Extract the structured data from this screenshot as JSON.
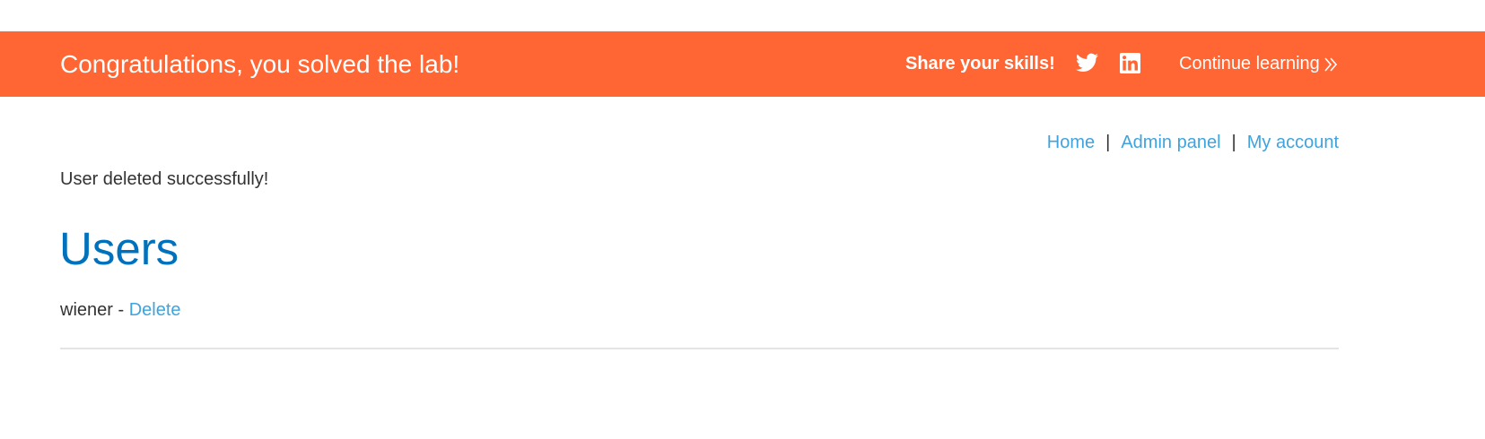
{
  "banner": {
    "title": "Congratulations, you solved the lab!",
    "share_label": "Share your skills!",
    "twitter_icon": "twitter-icon",
    "linkedin_icon": "linkedin-icon",
    "continue_label": "Continue learning",
    "background_color": "#ff6633"
  },
  "nav": {
    "items": [
      {
        "label": "Home"
      },
      {
        "label": "Admin panel"
      },
      {
        "label": "My account"
      }
    ],
    "separator": "|"
  },
  "status_message": "User deleted successfully!",
  "heading": "Users",
  "users": [
    {
      "name": "wiener",
      "separator": " - ",
      "action_label": "Delete"
    }
  ],
  "colors": {
    "link": "#3fa3dd",
    "heading": "#0071bc",
    "text": "#333333"
  }
}
